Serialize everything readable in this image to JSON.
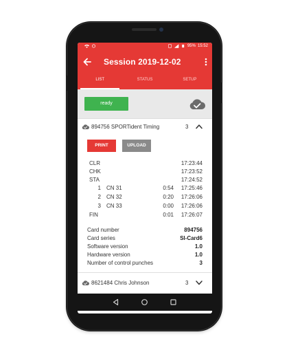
{
  "status_bar": {
    "battery": "95%",
    "time": "15:52"
  },
  "appbar": {
    "title": "Session 2019-12-02"
  },
  "tabs": [
    {
      "label": "LIST"
    },
    {
      "label": "STATUS"
    },
    {
      "label": "SETUP"
    }
  ],
  "ready_button": "ready",
  "cards": [
    {
      "title": "894756 SPORTident Timing",
      "count": "3",
      "expanded": true,
      "print_label": "PRINT",
      "upload_label": "UPLOAD",
      "special_punches_top": [
        {
          "code": "CLR",
          "time": "17:23:44"
        },
        {
          "code": "CHK",
          "time": "17:23:52"
        },
        {
          "code": "STA",
          "time": "17:24:52"
        }
      ],
      "controls": [
        {
          "num": "1",
          "cn": "CN 31",
          "split": "0:54",
          "time": "17:25:46"
        },
        {
          "num": "2",
          "cn": "CN 32",
          "split": "0:20",
          "time": "17:26:06"
        },
        {
          "num": "3",
          "cn": "CN 33",
          "split": "0:00",
          "time": "17:26:06"
        }
      ],
      "finish": {
        "code": "FIN",
        "split": "0:01",
        "time": "17:26:07"
      },
      "info": [
        {
          "label": "Card number",
          "value": "894756"
        },
        {
          "label": "Card series",
          "value": "SI-Card6"
        },
        {
          "label": "Software version",
          "value": "1.0"
        },
        {
          "label": "Hardware version",
          "value": "1.0"
        },
        {
          "label": "Number of control punches",
          "value": "3"
        }
      ]
    },
    {
      "title": "8621484 Chris Johnson",
      "count": "3",
      "expanded": false
    }
  ],
  "colors": {
    "primary": "#e53935",
    "ready": "#3fb34f",
    "upload": "#8a8a8a"
  }
}
